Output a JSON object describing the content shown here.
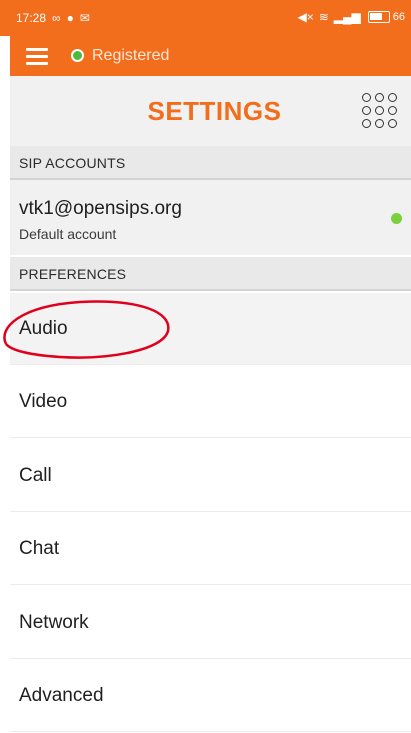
{
  "status_bar": {
    "time": "17:28",
    "battery": "66"
  },
  "app_bar": {
    "status_text": "Registered",
    "status_color": "#4cba3c",
    "background_color": "#f26d1c"
  },
  "header": {
    "title": "SETTINGS",
    "title_color": "#f26d1c",
    "dialpad_icon": "dialpad-icon"
  },
  "sip_accounts": {
    "section_label": "SIP ACCOUNTS",
    "accounts": [
      {
        "name": "vtk1@opensips.org",
        "subtitle": "Default account",
        "status_color": "#7ccf3d"
      }
    ]
  },
  "preferences": {
    "section_label": "PREFERENCES",
    "items": [
      {
        "label": "Audio"
      },
      {
        "label": "Video"
      },
      {
        "label": "Call"
      },
      {
        "label": "Chat"
      },
      {
        "label": "Network"
      },
      {
        "label": "Advanced"
      }
    ]
  },
  "annotation": {
    "highlight_color": "#e0001b"
  }
}
